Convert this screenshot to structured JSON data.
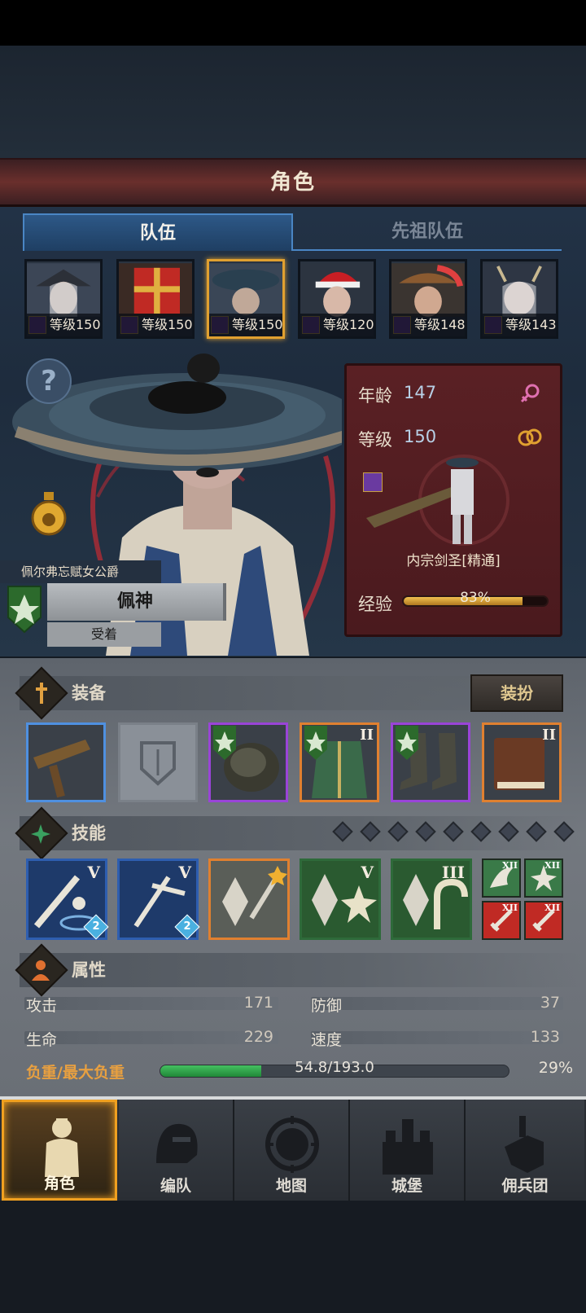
{
  "header": {
    "title": "角色"
  },
  "tabs": [
    {
      "label": "队伍"
    },
    {
      "label": "先祖队伍"
    }
  ],
  "party": [
    {
      "level": "等级150"
    },
    {
      "level": "等级150"
    },
    {
      "level": "等级150"
    },
    {
      "level": "等级120"
    },
    {
      "level": "等级148"
    },
    {
      "level": "等级143"
    }
  ],
  "hero": {
    "title": "佩尔弗忘赋女公爵",
    "name": "佩神",
    "status": "受着"
  },
  "info": {
    "age_label": "年龄",
    "age": "147",
    "level_label": "等级",
    "level": "150",
    "class_name": "内宗剑圣[精通]",
    "exp_label": "经验",
    "exp_text": "83%",
    "exp_fraction": 0.83
  },
  "equipment": {
    "section_label": "装备",
    "dress_button": "装扮",
    "slots": [
      {
        "roman": ""
      },
      {
        "roman": ""
      },
      {
        "roman": ""
      },
      {
        "roman": "II"
      },
      {
        "roman": ""
      },
      {
        "roman": "II"
      }
    ]
  },
  "skills": {
    "section_label": "技能",
    "items": [
      {
        "roman": "V",
        "badge": "2"
      },
      {
        "roman": "V",
        "badge": "2"
      },
      {
        "roman": ""
      },
      {
        "roman": "V"
      },
      {
        "roman": "III"
      }
    ],
    "mini": [
      {
        "roman": "XII"
      },
      {
        "roman": "XII"
      },
      {
        "roman": "XII"
      },
      {
        "roman": "XII"
      }
    ]
  },
  "attributes": {
    "section_label": "属性",
    "attack_label": "攻击",
    "attack": "171",
    "defense_label": "防御",
    "defense": "37",
    "hp_label": "生命",
    "hp": "229",
    "speed_label": "速度",
    "speed": "133",
    "load_label": "负重/最大负重",
    "load_text": "54.8/193.0",
    "load_pct": "29%",
    "load_fraction": 0.29
  },
  "nav": [
    {
      "label": "角色"
    },
    {
      "label": "编队"
    },
    {
      "label": "地图"
    },
    {
      "label": "城堡"
    },
    {
      "label": "佣兵团"
    }
  ]
}
